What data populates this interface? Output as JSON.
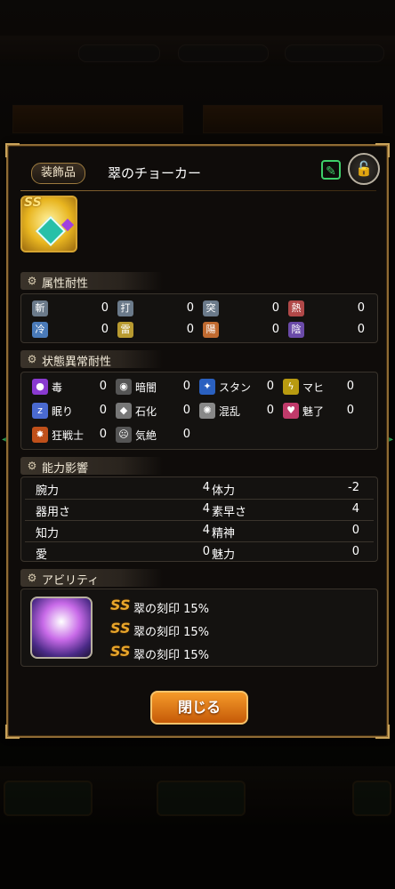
{
  "dialog": {
    "category": "装飾品",
    "item_name": "翠のチョーカー",
    "close_label": "閉じる",
    "icons": {
      "edit": "edit-icon",
      "lock": "unlock-icon"
    }
  },
  "sections": {
    "attr_resist": "属性耐性",
    "status_resist": "状態異常耐性",
    "ability_effect": "能力影響",
    "ability": "アビリティ"
  },
  "attr_resist": [
    {
      "icon": "斬",
      "value": "0",
      "color": "#6b7a8a"
    },
    {
      "icon": "打",
      "value": "0",
      "color": "#6b7a8a"
    },
    {
      "icon": "突",
      "value": "0",
      "color": "#6b7a8a"
    },
    {
      "icon": "熱",
      "value": "0",
      "color": "#b04848"
    },
    {
      "icon": "冷",
      "value": "0",
      "color": "#4a7ab8"
    },
    {
      "icon": "雷",
      "value": "0",
      "color": "#b89a30"
    },
    {
      "icon": "陽",
      "value": "0",
      "color": "#c06a30"
    },
    {
      "icon": "陰",
      "value": "0",
      "color": "#6a4aa8"
    }
  ],
  "status_resist": [
    {
      "name": "毒",
      "value": "0",
      "color": "#8a3ad0"
    },
    {
      "name": "暗闇",
      "value": "0",
      "color": "#555"
    },
    {
      "name": "スタン",
      "value": "0",
      "color": "#2a60c0"
    },
    {
      "name": "マヒ",
      "value": "0",
      "color": "#b89a10"
    },
    {
      "name": "眠り",
      "value": "0",
      "color": "#4a6ad0"
    },
    {
      "name": "石化",
      "value": "0",
      "color": "#777"
    },
    {
      "name": "混乱",
      "value": "0",
      "color": "#888"
    },
    {
      "name": "魅了",
      "value": "0",
      "color": "#c03a6a"
    },
    {
      "name": "狂戦士",
      "value": "0",
      "color": "#c0501a"
    },
    {
      "name": "気絶",
      "value": "0",
      "color": "#555"
    }
  ],
  "stats": [
    {
      "n1": "腕力",
      "v1": "4",
      "n2": "体力",
      "v2": "-2"
    },
    {
      "n1": "器用さ",
      "v1": "4",
      "n2": "素早さ",
      "v2": "4"
    },
    {
      "n1": "知力",
      "v1": "4",
      "n2": "精神",
      "v2": "0"
    },
    {
      "n1": "愛",
      "v1": "0",
      "n2": "魅力",
      "v2": "0"
    }
  ],
  "abilities": [
    {
      "mark": "SS",
      "text": "翠の刻印 15%"
    },
    {
      "mark": "SS",
      "text": "翠の刻印 15%"
    },
    {
      "mark": "SS",
      "text": "翠の刻印 15%"
    }
  ],
  "item_icon_mark": "SS"
}
